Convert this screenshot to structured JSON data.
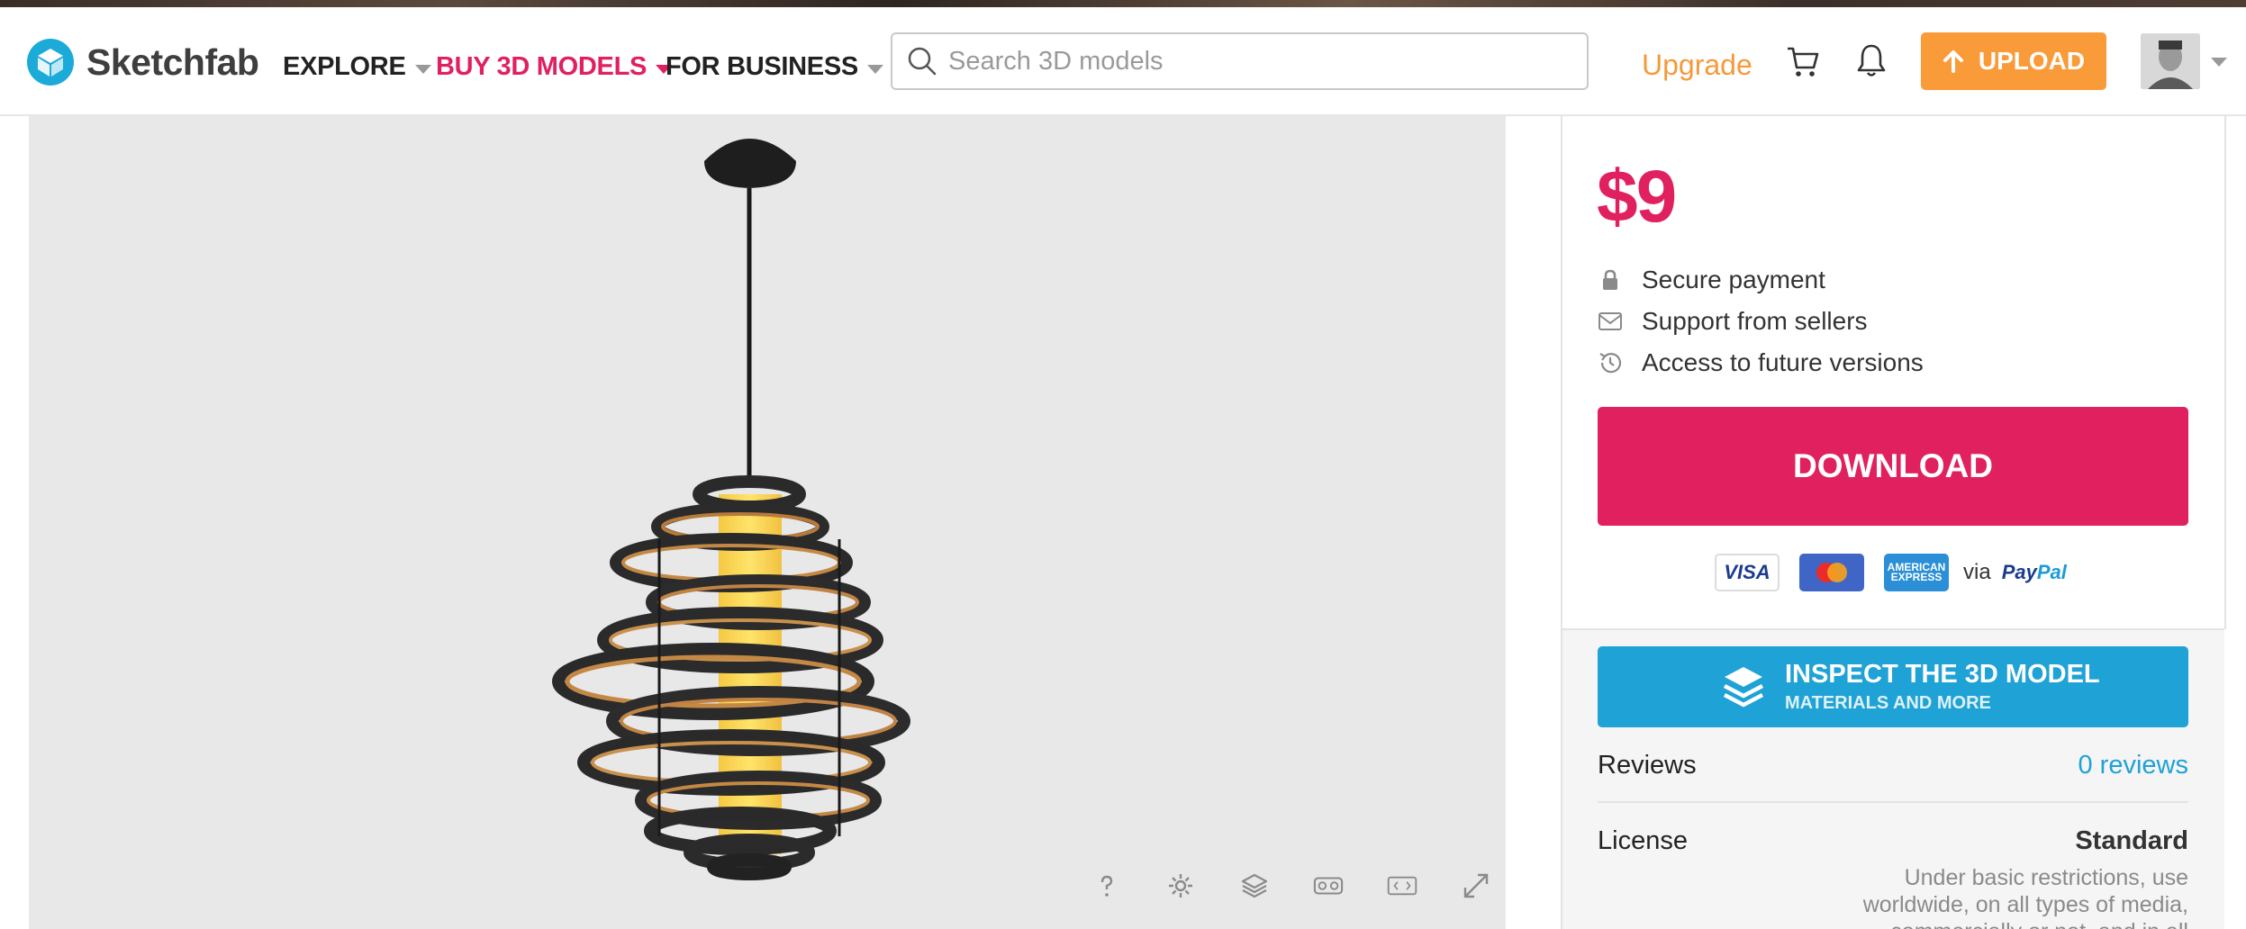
{
  "header": {
    "logo_text": "Sketchfab",
    "nav": {
      "explore": "EXPLORE",
      "buy": "BUY 3D MODELS",
      "business": "FOR BUSINESS"
    },
    "search_placeholder": "Search 3D models",
    "upgrade": "Upgrade",
    "upload": "UPLOAD"
  },
  "purchase": {
    "price": "$9",
    "perks": [
      "Secure payment",
      "Support from sellers",
      "Access to future versions"
    ],
    "download": "DOWNLOAD",
    "payment": {
      "visa": "VISA",
      "amex": "AMERICAN EXPRESS",
      "via": "via",
      "paypal_a": "Pay",
      "paypal_b": "Pal"
    }
  },
  "inspect": {
    "title": "INSPECT THE 3D MODEL",
    "subtitle": "MATERIALS AND MORE"
  },
  "details": {
    "reviews_label": "Reviews",
    "reviews_value": "0 reviews",
    "license_label": "License",
    "license_value": "Standard",
    "license_desc": "Under basic restrictions, use worldwide, on all types of media, commercially or not, and in all"
  },
  "viewer_controls": [
    "help-icon",
    "settings-icon",
    "layers-icon",
    "vr-icon",
    "inspector-icon",
    "fullscreen-icon"
  ],
  "colors": {
    "brand_blue": "#1caad9",
    "accent_pink": "#e0205f",
    "upload_orange": "#fa9b3a",
    "inspect_blue": "#1fa2d6"
  }
}
